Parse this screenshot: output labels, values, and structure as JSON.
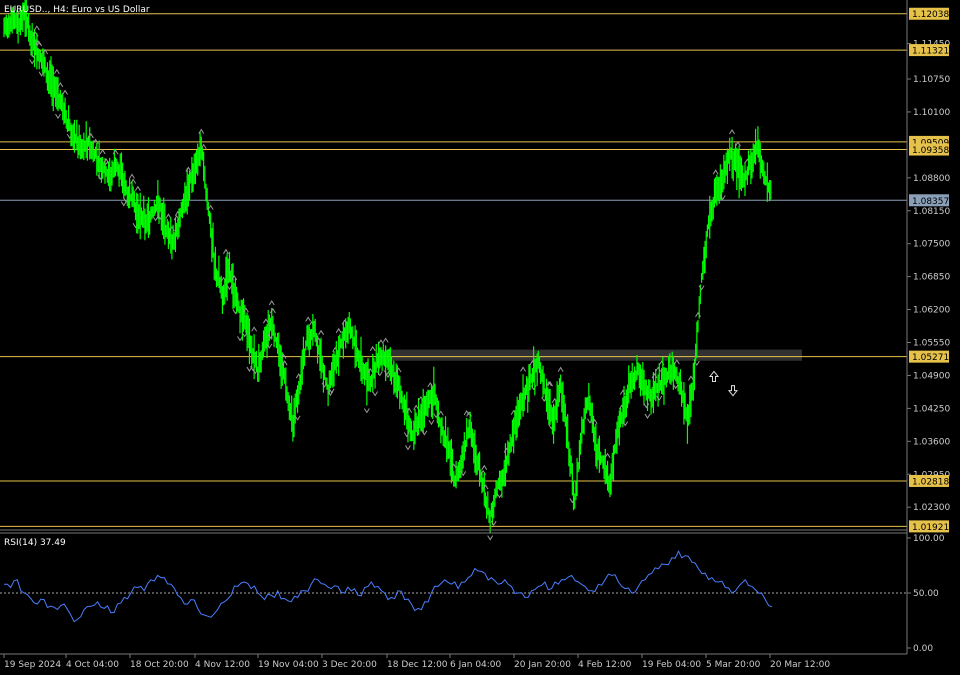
{
  "header": {
    "title": "EURUSD.., H4:  Euro vs US Dollar"
  },
  "chart_data": [
    {
      "type": "candlestick",
      "title": "EURUSD.., H4:  Euro vs US Dollar",
      "symbol": "EURUSD..",
      "timeframe": "H4",
      "description": "Euro vs US Dollar",
      "ylim": [
        1.0185,
        1.1225
      ],
      "y_ticks": [
        "1.12038",
        "1.11450",
        "1.11321",
        "1.10750",
        "1.10100",
        "1.09509",
        "1.09358",
        "1.08800",
        "1.08357",
        "1.08150",
        "1.07500",
        "1.06850",
        "1.06200",
        "1.05550",
        "1.05271",
        "1.04900",
        "1.04250",
        "1.03600",
        "1.02950",
        "1.02818",
        "1.02300",
        "1.01921"
      ],
      "current_price": "1.08357",
      "horizontal_levels": [
        "1.12038",
        "1.11321",
        "1.09509",
        "1.09358",
        "1.05271",
        "1.02818",
        "1.01921"
      ],
      "level_color": "#e6c24a",
      "bid_line_color": "#8aa0b8",
      "candle_color": "#00ff00",
      "fractal_color": "#9a9a9a",
      "zone": {
        "from": 1.0519,
        "to": 1.0541,
        "color": "#3a3a3a"
      },
      "arrows": [
        {
          "direction": "up",
          "price": 1.0488
        },
        {
          "direction": "down",
          "price": 1.046
        }
      ],
      "x_labels": [
        "19 Sep 2024",
        "4 Oct 04:00",
        "18 Oct 20:00",
        "4 Nov 12:00",
        "19 Nov 04:00",
        "3 Dec 20:00",
        "18 Dec 12:00",
        "6 Jan 04:00",
        "20 Jan 20:00",
        "4 Feb 12:00",
        "19 Feb 04:00",
        "5 Mar 20:00",
        "20 Mar 12:00"
      ],
      "series": [
        {
          "values": [
            1.117,
            1.1195,
            1.118,
            1.1205,
            1.115,
            1.112,
            1.109,
            1.106,
            1.103,
            1.099,
            1.096,
            1.094,
            1.095,
            1.0925,
            1.09,
            1.088,
            1.091,
            1.087,
            1.084,
            1.081,
            1.079,
            1.081,
            1.083,
            1.078,
            1.075,
            1.08,
            1.086,
            1.09,
            1.094,
            1.082,
            1.07,
            1.065,
            1.07,
            1.063,
            1.06,
            1.055,
            1.05,
            1.056,
            1.059,
            1.054,
            1.047,
            1.04,
            1.048,
            1.056,
            1.058,
            1.052,
            1.046,
            1.052,
            1.056,
            1.059,
            1.054,
            1.05,
            1.047,
            1.052,
            1.053,
            1.05,
            1.047,
            1.042,
            1.037,
            1.041,
            1.043,
            1.046,
            1.039,
            1.035,
            1.028,
            1.032,
            1.039,
            1.033,
            1.027,
            1.021,
            1.027,
            1.03,
            1.036,
            1.042,
            1.046,
            1.049,
            1.052,
            1.044,
            1.04,
            1.047,
            1.037,
            1.024,
            1.038,
            1.045,
            1.035,
            1.032,
            1.027,
            1.038,
            1.042,
            1.048,
            1.05,
            1.046,
            1.045,
            1.047,
            1.049,
            1.05,
            1.047,
            1.04,
            1.05,
            1.068,
            1.079,
            1.085,
            1.088,
            1.093,
            1.09,
            1.087,
            1.091,
            1.095,
            1.088,
            1.085
          ]
        },
        {
          "name": "RSI(14) 37.49",
          "values": [
            58,
            55,
            62,
            50,
            45,
            40,
            44,
            38,
            35,
            40,
            30,
            26,
            35,
            38,
            42,
            36,
            32,
            40,
            46,
            50,
            55,
            52,
            62,
            66,
            64,
            58,
            48,
            40,
            44,
            36,
            30,
            28,
            35,
            42,
            48,
            56,
            60,
            54,
            50,
            44,
            48,
            52,
            45,
            42,
            46,
            52,
            58,
            62,
            58,
            54,
            56,
            50,
            52,
            48,
            55,
            60,
            56,
            50,
            46,
            52,
            44,
            40,
            36,
            42,
            50,
            56,
            62,
            58,
            54,
            60,
            66,
            70,
            68,
            64,
            58,
            62,
            56,
            50,
            46,
            52,
            56,
            60,
            54,
            58,
            62,
            66,
            60,
            56,
            52,
            58,
            62,
            66,
            60,
            54,
            50,
            56,
            62,
            68,
            72,
            76,
            82,
            88,
            84,
            78,
            72,
            68,
            64,
            60,
            55,
            50,
            56,
            62,
            56,
            50,
            44,
            37.49
          ]
        }
      ]
    },
    {
      "type": "line",
      "title": "RSI(14) 37.49",
      "ylim": [
        0,
        100
      ],
      "y_ticks": [
        "100.00",
        "50.00",
        "0.00"
      ],
      "level": 50,
      "line_color": "#4a7dff"
    }
  ]
}
